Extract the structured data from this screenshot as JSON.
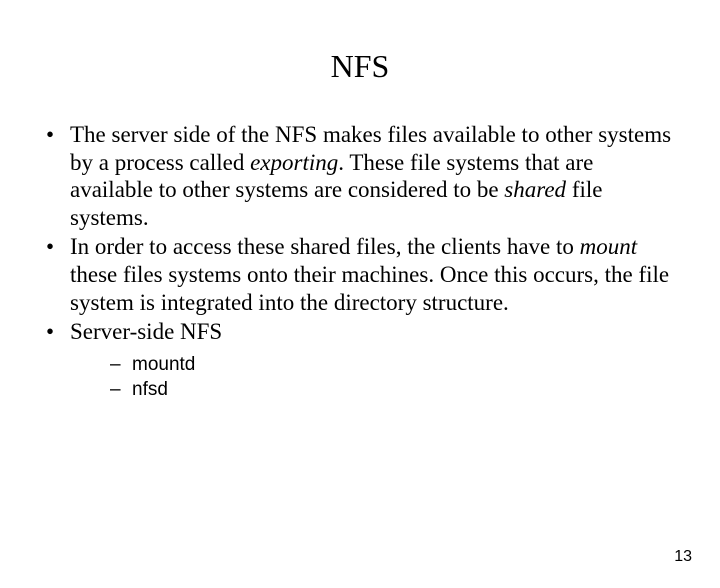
{
  "title": "NFS",
  "bullets": [
    {
      "pre": "The server side of the NFS makes files available to other systems by a process called ",
      "em1": "exporting",
      "mid": ". These file systems that are available to other systems are considered to be ",
      "em2": "shared",
      "post": " file systems."
    },
    {
      "pre": "In order to access these shared files, the clients have to ",
      "em1": "mount",
      "mid": " these files systems onto their machines. Once this occurs, the file system is integrated into the directory structure.",
      "em2": "",
      "post": ""
    },
    {
      "pre": "Server-side NFS",
      "em1": "",
      "mid": "",
      "em2": "",
      "post": ""
    }
  ],
  "subitems": [
    "mountd",
    "nfsd"
  ],
  "page_number": "13"
}
